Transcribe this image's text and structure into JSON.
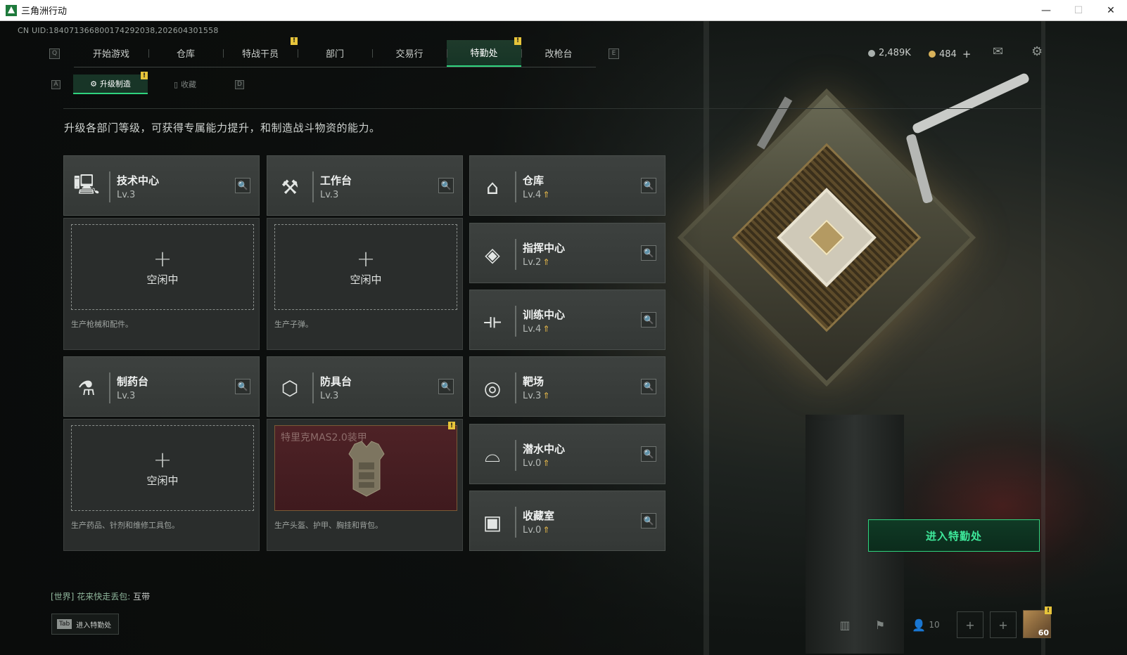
{
  "window": {
    "title": "三角洲行动",
    "minimize": "—",
    "maximize": "☐",
    "close": "✕"
  },
  "uid": "CN UID:1840713668001742920​38,202604301558",
  "topnav": {
    "left_key": "Q",
    "right_key": "E",
    "tabs": [
      {
        "label": "开始游戏",
        "active": false,
        "badge": ""
      },
      {
        "label": "仓库",
        "active": false,
        "badge": ""
      },
      {
        "label": "特战干员",
        "active": false,
        "badge": "!"
      },
      {
        "label": "部门",
        "active": false,
        "badge": ""
      },
      {
        "label": "交易行",
        "active": false,
        "badge": ""
      },
      {
        "label": "特勤处",
        "active": true,
        "badge": "!"
      },
      {
        "label": "改枪台",
        "active": false,
        "badge": ""
      }
    ]
  },
  "currency": {
    "silver": "2,489K",
    "gold": "484",
    "gold_add": "+",
    "silver_color": "#a9b0ad",
    "gold_color": "#d8b25a"
  },
  "subnav": {
    "left_key": "A",
    "right_key": "D",
    "tabs": [
      {
        "label": "升级制造",
        "active": true,
        "badge": "!"
      },
      {
        "label": "收藏",
        "active": false
      }
    ]
  },
  "description": "升级各部门等级，可获得专属能力提升，和制造战斗物资的能力。",
  "stations": [
    {
      "name": "技术中心",
      "level": "Lv.3",
      "upgrade": false,
      "icon": "computer-icon",
      "glyph": "🖳"
    },
    {
      "name": "工作台",
      "level": "Lv.3",
      "upgrade": false,
      "icon": "hammer-wrench-icon",
      "glyph": "⚒"
    },
    {
      "name": "仓库",
      "level": "Lv.4",
      "upgrade": true,
      "icon": "warehouse-icon",
      "glyph": "⌂"
    },
    {
      "name": "指挥中心",
      "level": "Lv.2",
      "upgrade": true,
      "icon": "command-diamond-icon",
      "glyph": "◈"
    },
    {
      "name": "训练中心",
      "level": "Lv.4",
      "upgrade": true,
      "icon": "dumbbell-icon",
      "glyph": "⟛"
    },
    {
      "name": "制药台",
      "level": "Lv.3",
      "upgrade": false,
      "icon": "microscope-icon",
      "glyph": "⚗"
    },
    {
      "name": "防具台",
      "level": "Lv.3",
      "upgrade": false,
      "icon": "armor-blocks-icon",
      "glyph": "⬡"
    },
    {
      "name": "靶场",
      "level": "Lv.3",
      "upgrade": true,
      "icon": "target-icon",
      "glyph": "◎"
    },
    {
      "name": "潜水中心",
      "level": "Lv.0",
      "upgrade": true,
      "icon": "diving-mask-icon",
      "glyph": "⌓"
    },
    {
      "name": "收藏室",
      "level": "Lv.0",
      "upgrade": true,
      "icon": "collection-room-icon",
      "glyph": "▣"
    }
  ],
  "upgrade_glyph": "⇑",
  "slots": [
    {
      "state": "idle",
      "plus": "+",
      "label": "空闲中",
      "footer": "生产枪械和配件。"
    },
    {
      "state": "idle",
      "plus": "+",
      "label": "空闲中",
      "footer": "生产子弹。"
    },
    {
      "state": "idle",
      "plus": "+",
      "label": "空闲中",
      "footer": "生产药品、针剂和维修工具包。"
    },
    {
      "state": "busy",
      "item": "特里克MAS2.0装甲",
      "badge": "!",
      "footer": "生产头盔、护甲、胸挂和背包。"
    }
  ],
  "enter_button": "进入特勤处",
  "chat": {
    "channel": "[世界]",
    "sender": "花来快走丢包:",
    "message": "互带"
  },
  "tab_hint": {
    "key": "Tab",
    "label": "进入特勤处"
  },
  "bottom": {
    "friends_count": "10",
    "avatar_level": "60",
    "avatar_badge": "!"
  },
  "accent_color": "#2fd37e"
}
